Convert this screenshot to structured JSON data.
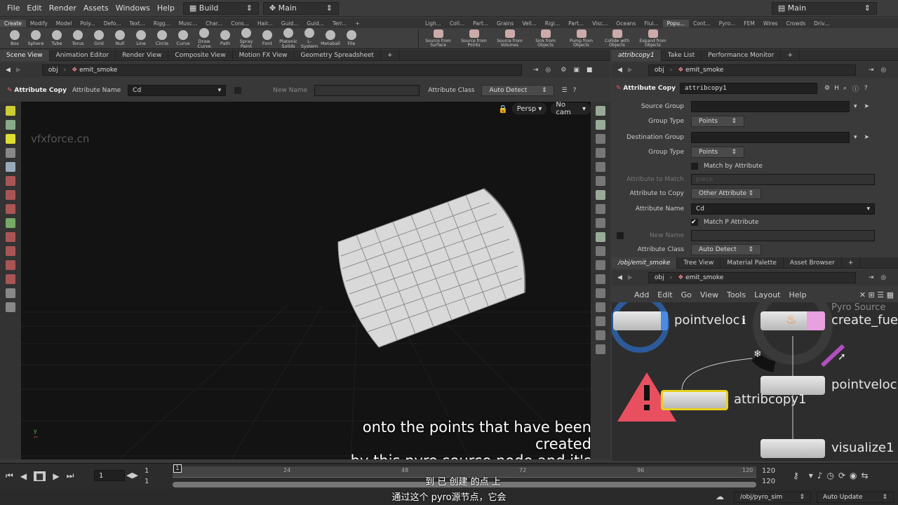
{
  "menu": [
    "File",
    "Edit",
    "Render",
    "Assets",
    "Windows",
    "Help"
  ],
  "desktop_left": "Build",
  "desktop_mid": "Main",
  "desktop_right": "Main",
  "shelf_tabs_left": [
    "Create",
    "Modify",
    "Model",
    "Poly...",
    "Defo...",
    "Text...",
    "Rigg...",
    "Musc...",
    "Char...",
    "Cons...",
    "Hair...",
    "Guid...",
    "Guid...",
    "Terr..."
  ],
  "shelf_tabs_right": [
    "Ligh...",
    "Coll...",
    "Part...",
    "Grains",
    "Vell...",
    "Rigi...",
    "Part...",
    "Visc...",
    "Oceans",
    "Flui...",
    "Popu...",
    "Cont...",
    "Pyro...",
    "FEM",
    "Wires",
    "Crowds",
    "Driv..."
  ],
  "tools_left": [
    "Box",
    "Sphere",
    "Tube",
    "Torus",
    "Grid",
    "Null",
    "Line",
    "Circle",
    "Curve",
    "Draw Curve",
    "Path",
    "Spray Paint",
    "Font",
    "Platonic Solids",
    "L-System",
    "Metaball",
    "File"
  ],
  "tools_right": [
    "Source from Surface",
    "Source from Points",
    "Source from Volumes",
    "Sink from Objects",
    "Pump from Objects",
    "Collide with Objects",
    "Expand from Objects"
  ],
  "left_panel": {
    "tabs": [
      "Scene View",
      "Animation Editor",
      "Render View",
      "Composite View",
      "Motion FX View",
      "Geometry Spreadsheet"
    ],
    "path_root": "obj",
    "path_node": "emit_smoke",
    "op_title": "Attribute Copy",
    "attr_name_label": "Attribute Name",
    "attr_name_value": "Cd",
    "new_name_label": "New Name",
    "attr_class_label": "Attribute Class",
    "attr_class_value": "Auto Detect",
    "persp": "Persp",
    "cam": "No cam",
    "watermark": "vfxforce.cn"
  },
  "right_panel": {
    "tabs": [
      "attribcopy1",
      "Take List",
      "Performance Monitor"
    ],
    "path_root": "obj",
    "path_node": "emit_smoke",
    "op_type": "Attribute Copy",
    "op_name": "attribcopy1",
    "params": [
      {
        "label": "Source Group",
        "value": ""
      },
      {
        "label": "Group Type",
        "value": "Points"
      },
      {
        "label": "Destination Group",
        "value": ""
      },
      {
        "label": "Group Type",
        "value": "Points"
      },
      {
        "label": "",
        "value": "Match by Attribute"
      },
      {
        "label": "Attribute to Match",
        "value": "piece"
      },
      {
        "label": "Attribute to Copy",
        "value": "Other Attribute"
      },
      {
        "label": "Attribute Name",
        "value": "Cd"
      },
      {
        "label": "",
        "value": "Match P Attribute"
      },
      {
        "label": "New Name",
        "value": ""
      },
      {
        "label": "Attribute Class",
        "value": "Auto Detect"
      }
    ]
  },
  "network": {
    "tabs": [
      "/obj/emit_smoke",
      "Tree View",
      "Material Palette",
      "Asset Browser"
    ],
    "path_root": "obj",
    "path_node": "emit_smoke",
    "menu": [
      "Add",
      "Edit",
      "Go",
      "View",
      "Tools",
      "Layout",
      "Help"
    ],
    "nodes": [
      "pointveloc",
      "create_fuel",
      "pointvelocit",
      "attribcopy1",
      "visualize1"
    ],
    "pyro_label": "Pyro Source"
  },
  "timeline": {
    "frame": "1",
    "start": "1",
    "start2": "1",
    "end": "120",
    "end2": "120",
    "ticks": [
      "1",
      "24",
      "48",
      "72",
      "96",
      "120"
    ]
  },
  "subtitle_en_1": "onto the points that have been created",
  "subtitle_en_2": "by this pyro source node and it's gonna",
  "subtitle_cn_1": "到 已 创建 的点 上",
  "subtitle_cn_2": "通过这个 pyro源节点，它会",
  "status": {
    "path": "/obj/pyro_sim",
    "update": "Auto Update"
  }
}
